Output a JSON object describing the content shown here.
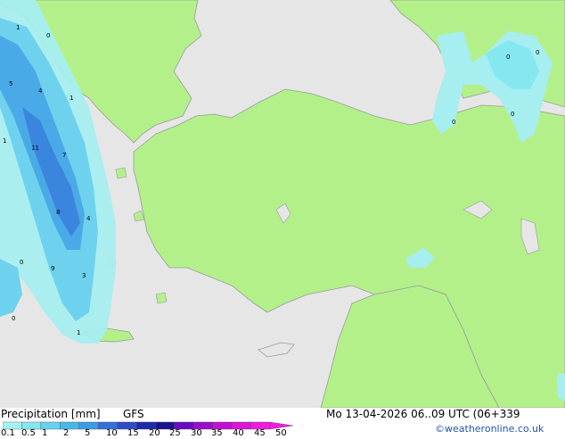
{
  "title": "Precipitation [mm]",
  "model": "GFS",
  "valid_time": "Mo 13-04-2026 06..09 UTC (06+339",
  "credit": "©weatheronline.co.uk",
  "legend": {
    "ticks": [
      "0.1",
      "0.5",
      "1",
      "2",
      "5",
      "10",
      "15",
      "20",
      "25",
      "30",
      "35",
      "40",
      "45",
      "50"
    ],
    "colors": [
      "#a5f3f3",
      "#85e8f0",
      "#63d3ee",
      "#45b8ec",
      "#3b9ce6",
      "#3270d8",
      "#2d4cc6",
      "#1d2aa8",
      "#1b128e",
      "#6a0ac0",
      "#9a0ccc",
      "#c20fd2",
      "#de14d8",
      "#f01ce0"
    ]
  },
  "map_labels": [
    "1",
    "0",
    "5",
    "4",
    "1",
    "1",
    "11",
    "7",
    "8",
    "4",
    "0",
    "9",
    "3",
    "0",
    "1",
    "0",
    "0",
    "0",
    "0"
  ],
  "colors": {
    "sea": "#e6e6e6",
    "land": "#b3f08a",
    "coast": "#9a9a9a",
    "light_precip": "#a6eef0",
    "mid_precip": "#6ed2ee",
    "heavy_precip": "#4aaae8",
    "max_precip": "#3a86de"
  }
}
